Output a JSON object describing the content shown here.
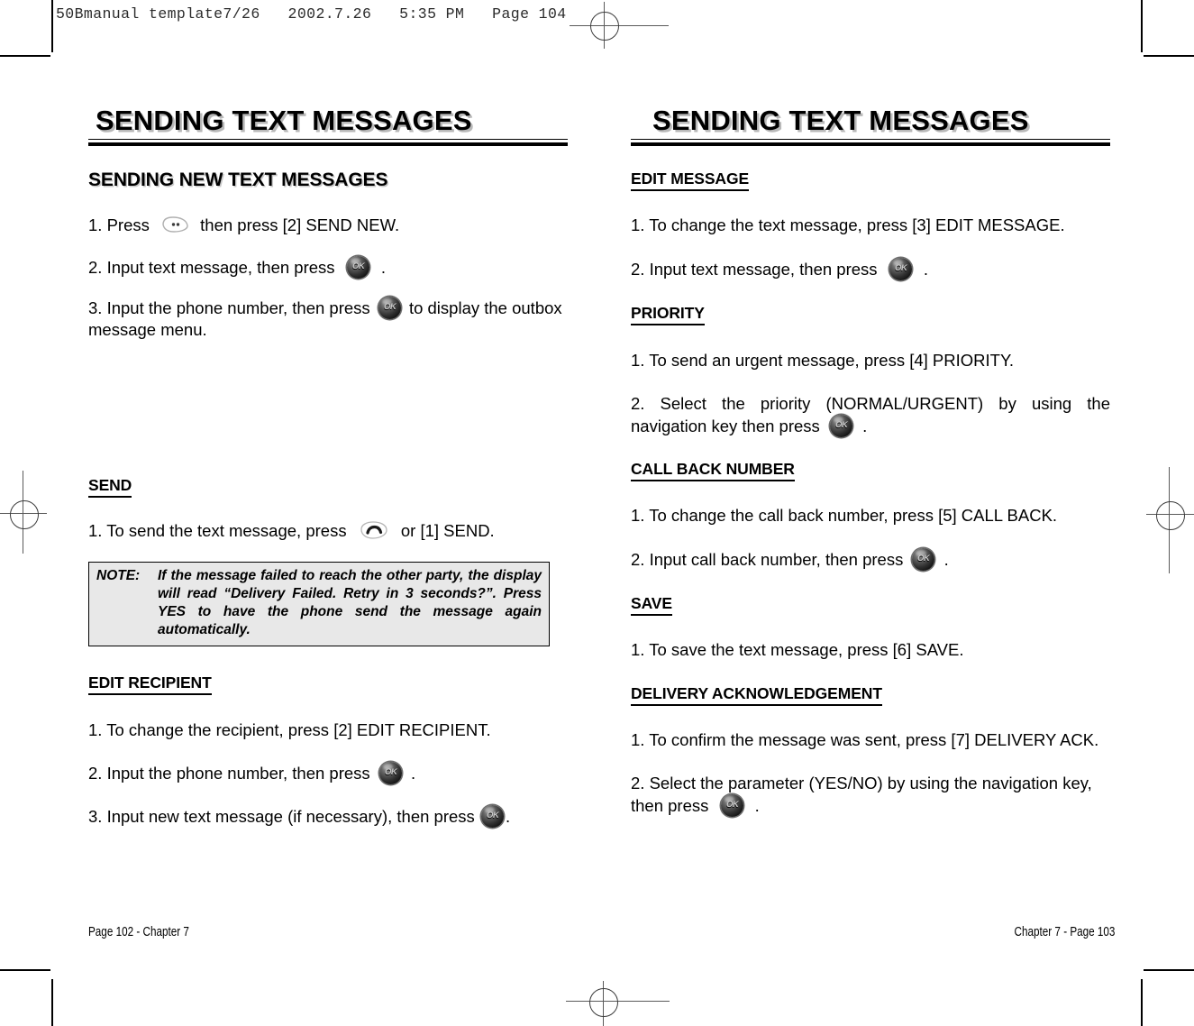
{
  "film_header": "50Bmanual template7/26   2002.7.26   5:35 PM   Page 104",
  "left_page": {
    "banner_title": "SENDING TEXT MESSAGES",
    "section_title": "SENDING NEW TEXT MESSAGES",
    "steps_intro": [
      {
        "pre": "1. Press",
        "icon": "menu-key-icon",
        "post": "then press [2] SEND NEW."
      },
      {
        "pre": "2. Input text message, then press",
        "icon": "ok-key-icon",
        "post": "."
      },
      {
        "pre": "3. Input the phone number, then press",
        "icon": "ok-key-icon",
        "post": "to display the outbox message menu."
      }
    ],
    "send": {
      "heading": "SEND",
      "step": {
        "pre": "1. To send the text message, press",
        "icon": "send-key-icon",
        "post": "or [1] SEND."
      }
    },
    "note": {
      "label": "NOTE:",
      "text": "If the message failed to reach the other party, the display will read “Delivery Failed. Retry in 3 seconds?”. Press YES to have the phone send the message again automatically."
    },
    "edit_recipient": {
      "heading": "EDIT RECIPIENT",
      "steps": [
        {
          "pre": "1. To change the recipient, press [2] EDIT RECIPIENT.",
          "icon": "",
          "post": ""
        },
        {
          "pre": "2. Input the phone number, then press",
          "icon": "ok-key-icon",
          "post": "."
        },
        {
          "pre": "3. Input new text message (if necessary), then press",
          "icon": "ok-key-icon",
          "post": "."
        }
      ]
    },
    "footer": "Page 102 - Chapter 7"
  },
  "right_page": {
    "banner_title": "SENDING TEXT MESSAGES",
    "edit_message": {
      "heading": "EDIT MESSAGE",
      "steps": [
        {
          "pre": "1. To change the text message, press [3] EDIT MESSAGE.",
          "icon": "",
          "post": ""
        },
        {
          "pre": "2.  Input text message, then press",
          "icon": "ok-key-icon",
          "post": "."
        }
      ]
    },
    "priority": {
      "heading": "PRIORITY",
      "steps": [
        {
          "pre": "1. To send an urgent message, press [4] PRIORITY.",
          "icon": "",
          "post": ""
        },
        {
          "pre": "2. Select the priority (NORMAL/URGENT) by using the navigation key then press",
          "icon": "ok-key-icon",
          "post": "."
        }
      ]
    },
    "call_back": {
      "heading": "CALL BACK NUMBER",
      "steps": [
        {
          "pre": "1. To change the call back number, press [5] CALL BACK.",
          "icon": "",
          "post": ""
        },
        {
          "pre": "2. Input call back number, then press",
          "icon": "ok-key-icon",
          "post": "."
        }
      ]
    },
    "save": {
      "heading": "SAVE",
      "steps": [
        {
          "pre": "1. To save the text message, press [6] SAVE.",
          "icon": "",
          "post": ""
        }
      ]
    },
    "delivery_ack": {
      "heading": "DELIVERY ACKNOWLEDGEMENT",
      "steps": [
        {
          "pre": "1. To confirm the message was sent, press [7] DELIVERY ACK.",
          "icon": "",
          "post": ""
        },
        {
          "pre": "2. Select the parameter (YES/NO) by using the navigation key, then press",
          "icon": "ok-key-icon",
          "post": "."
        }
      ]
    },
    "footer": "Chapter 7 - Page 103"
  }
}
